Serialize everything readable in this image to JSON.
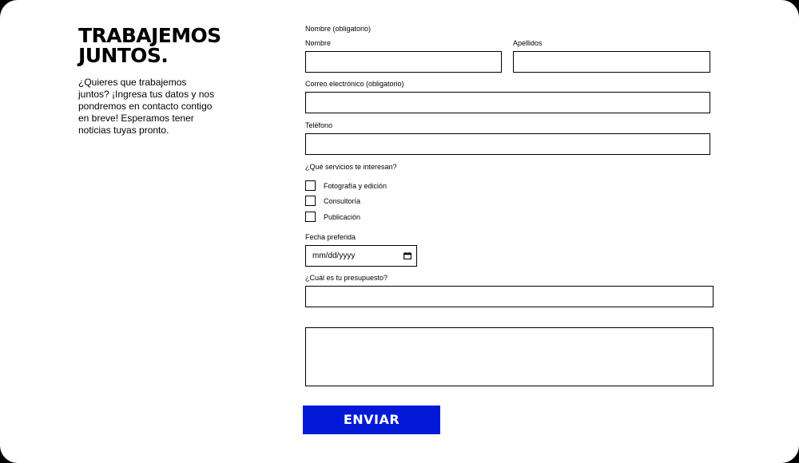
{
  "intro": {
    "title_line1": "TRABAJEMOS",
    "title_line2": "JUNTOS.",
    "description": "¿Quieres que trabajemos juntos? ¡Ingresa tus datos y nos pondremos en contacto contigo en breve! Esperamos tener noticias tuyas pronto."
  },
  "form": {
    "name_group_label": "Nombre (obligatorio)",
    "first_name_label": "Nombre",
    "first_name_value": "",
    "last_name_label": "Apellidos",
    "last_name_value": "",
    "email_label": "Correo electrónico (obligatorio)",
    "email_value": "",
    "phone_label": "Teléfono",
    "phone_value": "",
    "services_label": "¿Qué servicios te interesan?",
    "services": [
      {
        "label": "Fotografía y edición",
        "checked": false
      },
      {
        "label": "Consultoría",
        "checked": false
      },
      {
        "label": "Publicación",
        "checked": false
      }
    ],
    "date_label": "Fecha preferida",
    "date_placeholder": "mm/dd/yyyy",
    "date_icon": "calendar-icon",
    "budget_label": "¿Cuál es tu presupuesto?",
    "budget_value": "",
    "message_value": "",
    "submit_label": "ENVIAR"
  },
  "colors": {
    "page_background": "#000000",
    "card_background": "#ffffff",
    "submit_button": "#0319d8",
    "submit_text": "#ffffff"
  }
}
